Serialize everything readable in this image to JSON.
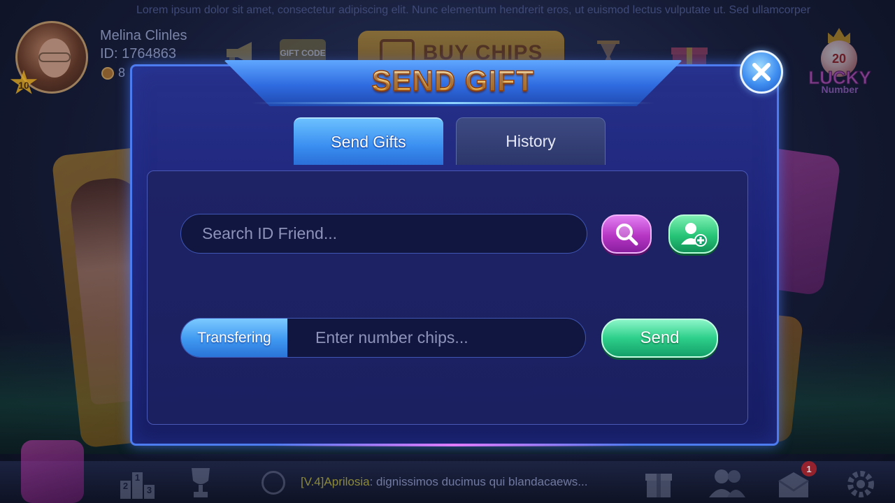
{
  "background": {
    "ticker_text": "Lorem ipsum dolor sit amet, consectetur adipiscing elit. Nunc elementum hendrerit eros, ut euismod lectus vulputate ut. Sed ullamcorper",
    "user": {
      "name": "Melina Clinles",
      "id": "ID: 1764863",
      "chips": "8",
      "level": "10"
    },
    "top_bar": {
      "gift_code": "GIFT CODE",
      "buy_chips": "BUY CHIPS",
      "lucky_number_ball": "20",
      "lucky": "LUCKY",
      "number": "Number"
    },
    "bottom_bar": {
      "ranking_digits": [
        "2",
        "1",
        "3"
      ],
      "chat_user": "[V.4]Aprilosia",
      "chat_message": ": dignissimos ducimus qui blandacaews...",
      "mail_badge": "1"
    }
  },
  "modal": {
    "title": "SEND GIFT",
    "tabs": [
      {
        "label": "Send Gifts",
        "active": true
      },
      {
        "label": "History",
        "active": false
      }
    ],
    "search": {
      "value": "",
      "placeholder": "Search ID Friend..."
    },
    "transfer": {
      "label": "Transfering",
      "value": "",
      "placeholder": "Enter number chips..."
    },
    "send_label": "Send",
    "icons": {
      "close": "close-icon",
      "search": "search-icon",
      "add_friend": "add-friend-icon"
    }
  },
  "colors": {
    "modal_bg": "#1d2479",
    "modal_border": "#4d7bf0",
    "tab_active": "#3a8ef0",
    "search_button": "#b636c4",
    "add_friend_button": "#26c477",
    "send_button": "#2dcf8a",
    "title_gold": "#ffd270"
  }
}
